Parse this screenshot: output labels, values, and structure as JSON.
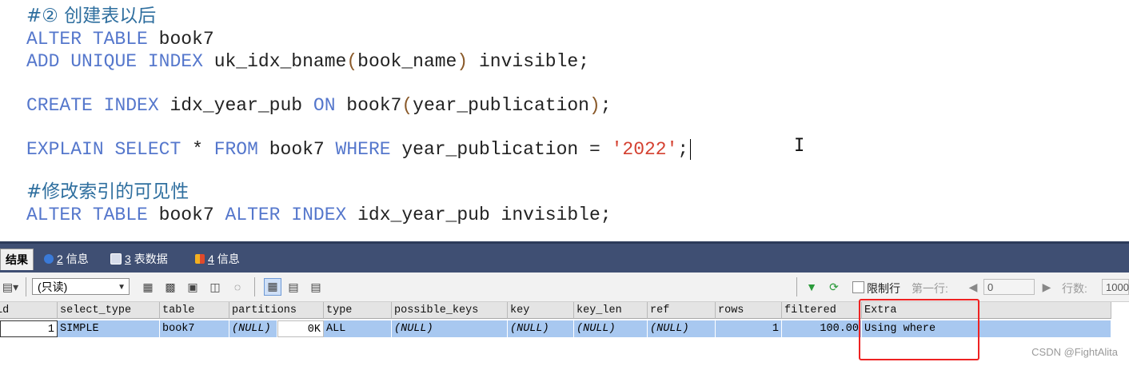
{
  "editor": {
    "lines": [
      {
        "type": "comment",
        "text": "#② 创建表以后"
      },
      {
        "type": "code",
        "parts": [
          [
            "kw",
            "ALTER"
          ],
          [
            "sp",
            " "
          ],
          [
            "kw",
            "TABLE"
          ],
          [
            "id",
            " book7"
          ]
        ]
      },
      {
        "type": "code",
        "parts": [
          [
            "kw",
            "ADD"
          ],
          [
            "sp",
            " "
          ],
          [
            "kw",
            "UNIQUE"
          ],
          [
            "sp",
            " "
          ],
          [
            "kw",
            "INDEX"
          ],
          [
            "id",
            " uk_idx_bname"
          ],
          [
            "paren",
            "("
          ],
          [
            "id",
            "book_name"
          ],
          [
            "paren",
            ")"
          ],
          [
            "id",
            " invisible;"
          ]
        ]
      },
      {
        "type": "code",
        "parts": [
          [
            "kw",
            "CREATE"
          ],
          [
            "sp",
            " "
          ],
          [
            "kw",
            "INDEX"
          ],
          [
            "id",
            " idx_year_pub "
          ],
          [
            "kw",
            "ON"
          ],
          [
            "id",
            " book7"
          ],
          [
            "paren",
            "("
          ],
          [
            "id",
            "year_publication"
          ],
          [
            "paren",
            ")"
          ],
          [
            "id",
            ";"
          ]
        ]
      },
      {
        "type": "code",
        "parts": [
          [
            "kw",
            "EXPLAIN"
          ],
          [
            "sp",
            " "
          ],
          [
            "kw",
            "SELECT"
          ],
          [
            "id",
            " * "
          ],
          [
            "kw",
            "FROM"
          ],
          [
            "id",
            " book7 "
          ],
          [
            "kw",
            "WHERE"
          ],
          [
            "id",
            " year_publication = "
          ],
          [
            "str",
            "'2022'"
          ],
          [
            "id",
            ";"
          ]
        ]
      },
      {
        "type": "comment",
        "text": "#修改索引的可见性"
      },
      {
        "type": "code",
        "parts": [
          [
            "kw",
            "ALTER"
          ],
          [
            "sp",
            " "
          ],
          [
            "kw",
            "TABLE"
          ],
          [
            "id",
            " book7 "
          ],
          [
            "kw",
            "ALTER"
          ],
          [
            "sp",
            " "
          ],
          [
            "kw",
            "INDEX"
          ],
          [
            "id",
            " idx_year_pub invisible;"
          ]
        ]
      }
    ]
  },
  "tabs": [
    {
      "label": "结果",
      "active": true
    },
    {
      "num": "2",
      "label": "信息",
      "icon": "info-icon"
    },
    {
      "num": "3",
      "label": "表数据",
      "icon": "table-data-icon"
    },
    {
      "num": "4",
      "label": "信息",
      "icon": "info-chart-icon"
    }
  ],
  "toolbar": {
    "select_value": "(只读)",
    "limit_label": "限制行",
    "first_row_label": "第一行:",
    "first_row_value": "0",
    "rows_label": "行数:",
    "rows_value": "1000"
  },
  "grid": {
    "columns": [
      "id",
      "select_type",
      "table",
      "partitions",
      "type",
      "possible_keys",
      "key",
      "key_len",
      "ref",
      "rows",
      "filtered",
      "Extra"
    ],
    "rows": [
      [
        "1",
        "SIMPLE",
        "book7",
        "(NULL)",
        "ALL",
        "(NULL)",
        "(NULL)",
        "(NULL)",
        "(NULL)",
        "1",
        "100.00",
        "Using where"
      ]
    ],
    "partitions_extra": "0K"
  },
  "watermark": "CSDN @FightAlita",
  "colors": {
    "keyword": "#5577cc",
    "string": "#d44030",
    "highlight_box": "#ee2222",
    "selected_row": "#a8c8f0"
  }
}
